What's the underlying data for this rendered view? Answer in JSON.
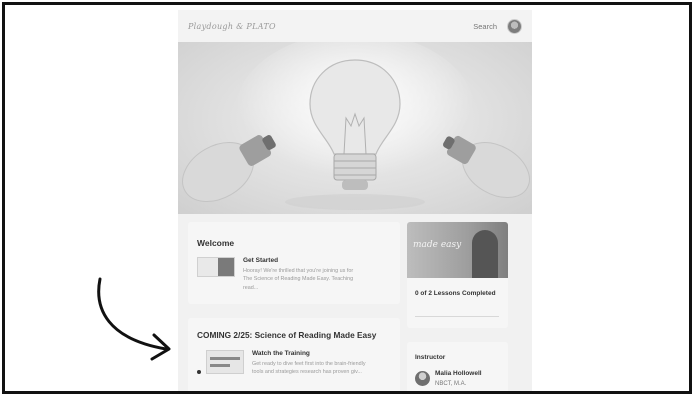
{
  "header": {
    "logo": "Playdough & PLATO",
    "search": "Search"
  },
  "welcome": {
    "title": "Welcome",
    "lesson": {
      "title": "Get Started",
      "description": "Hooray! We're thrilled that you're joining us for The Science of Reading Made Easy. Teaching read..."
    }
  },
  "coming": {
    "title": "COMING 2/25: Science of Reading Made Easy",
    "lesson": {
      "title": "Watch the Training",
      "description": "Get ready to dive feet first into the brain-friendly tools and strategies research has proven giv..."
    }
  },
  "course_card": {
    "image_text": "made easy",
    "progress": "0 of 2 Lessons Completed"
  },
  "instructor": {
    "heading": "Instructor",
    "name": "Malia Hollowell",
    "credentials": "NBCT, M.A."
  }
}
